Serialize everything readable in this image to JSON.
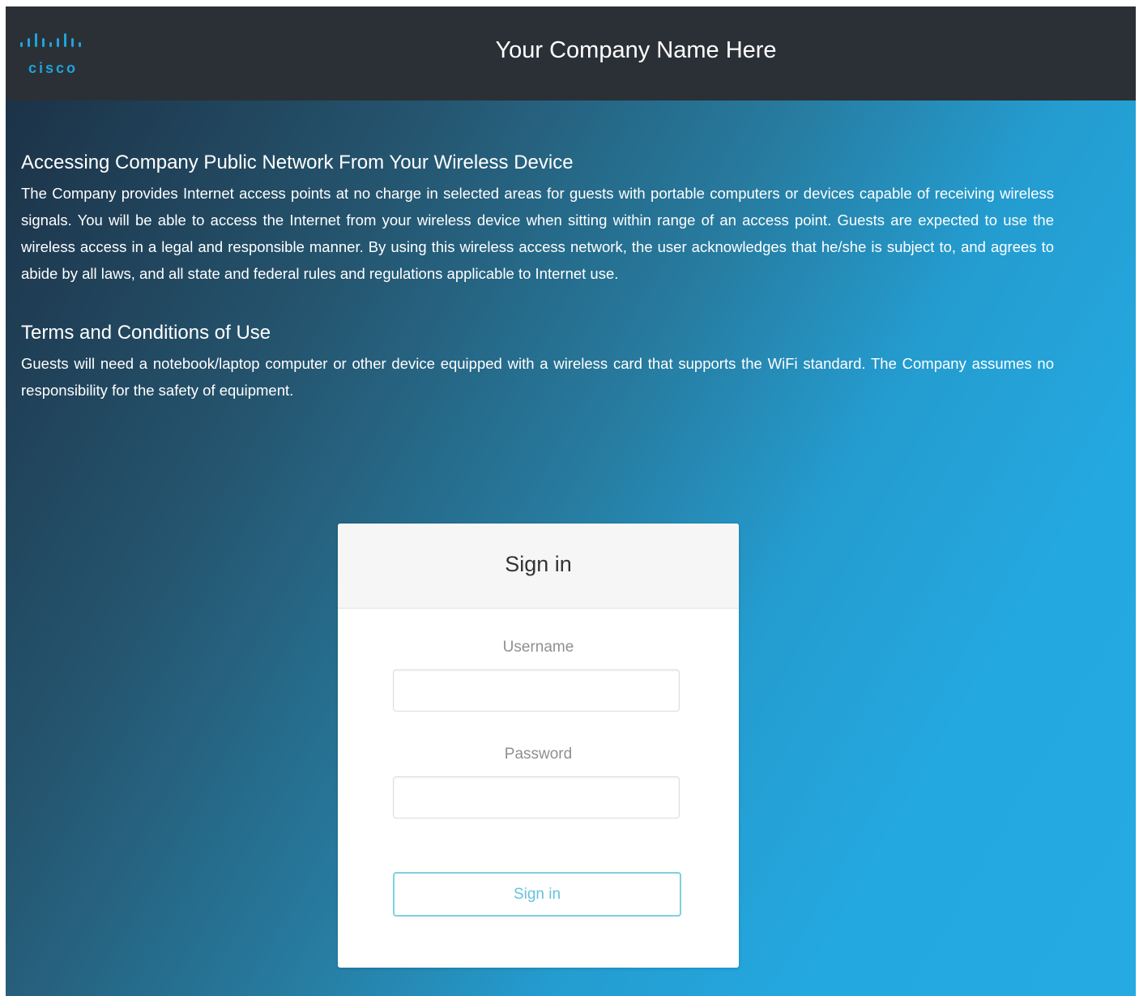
{
  "header": {
    "logo_text": "cisco",
    "company_name": "Your Company Name Here"
  },
  "section1": {
    "title": "Accessing Company Public Network From Your Wireless Device",
    "body": "The Company provides Internet access points at no charge in selected areas for guests with portable computers or devices capable of receiving wireless signals. You will be able to access the Internet from your wireless device when sitting within range of an access point. Guests are expected to use the wireless access in a legal and responsible manner. By using this wireless access network, the user acknowledges that he/she is subject to, and agrees to abide by all laws, and all state and federal rules and regulations applicable to Internet use."
  },
  "section2": {
    "title": "Terms and Conditions of Use",
    "body": "Guests will need a notebook/laptop computer or other device equipped with a wireless card that supports the WiFi standard. The Company assumes no responsibility for the safety of equipment."
  },
  "signin": {
    "heading": "Sign in",
    "username_label": "Username",
    "username_value": "",
    "password_label": "Password",
    "password_value": "",
    "button_label": "Sign in"
  },
  "colors": {
    "header_bg": "#2b3036",
    "logo_blue": "#1fa4da",
    "button_border": "#7fd0de",
    "button_text": "#67c2dd"
  },
  "icons": {
    "logo": "cisco-logo"
  }
}
